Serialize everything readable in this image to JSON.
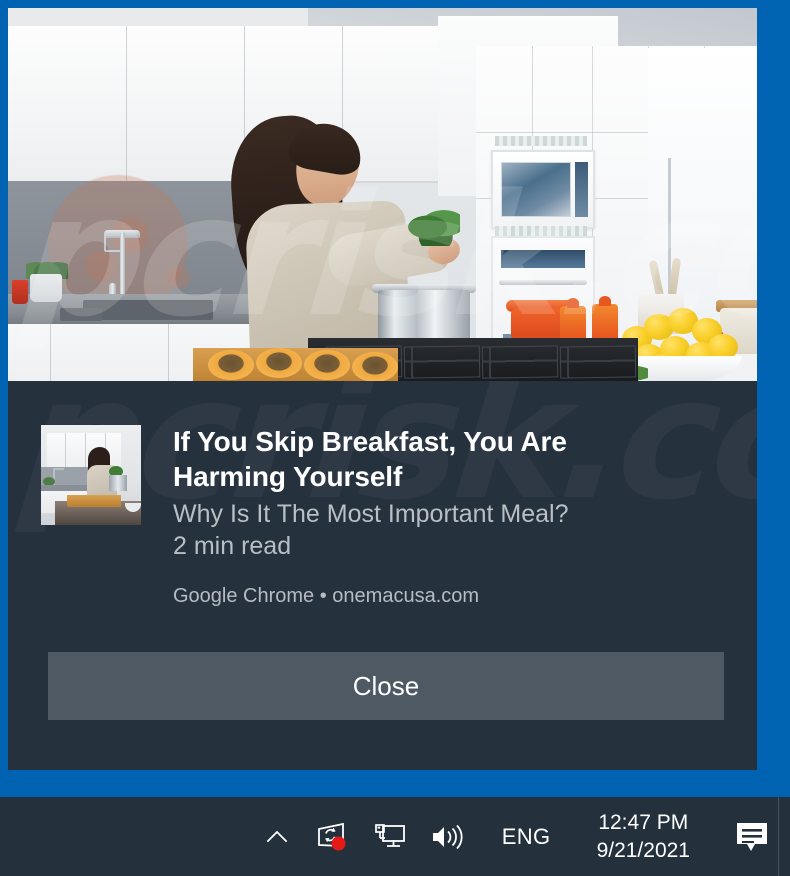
{
  "notification": {
    "hero_image_alt": "Woman cooking in a modern white kitchen",
    "thumbnail_alt": "Woman cooking in a kitchen thumbnail",
    "title": "If You Skip Breakfast, You Are Harming Yourself",
    "subtitle": "Why Is It The Most Important Meal? 2 min read",
    "subtitle_line1": "Why Is It The Most Important Meal?",
    "subtitle_line2": "2 min read",
    "source": "Google Chrome • onemacusa.com",
    "source_app": "Google Chrome",
    "source_domain": "onemacusa.com",
    "close_label": "Close"
  },
  "watermark": {
    "text": "pcrisk.com"
  },
  "taskbar": {
    "tray_icons": [
      {
        "name": "show-hidden-icons-chevron",
        "label": "Show hidden icons"
      },
      {
        "name": "onedrive-sync-icon",
        "label": "OneDrive sync pending",
        "badge_color": "#e61919"
      },
      {
        "name": "network-icon",
        "label": "Network"
      },
      {
        "name": "volume-icon",
        "label": "Volume"
      }
    ],
    "language": "ENG",
    "time": "12:47 PM",
    "date": "9/21/2021",
    "action_center": "Action Center"
  },
  "colors": {
    "accent_blue": "#0063b1",
    "toast_bg": "#25313d",
    "taskbar_bg": "#24313d",
    "button_bg": "#4f5964",
    "title_text": "#ffffff",
    "secondary_text": "#b9bfc4",
    "badge_red": "#e61919"
  }
}
